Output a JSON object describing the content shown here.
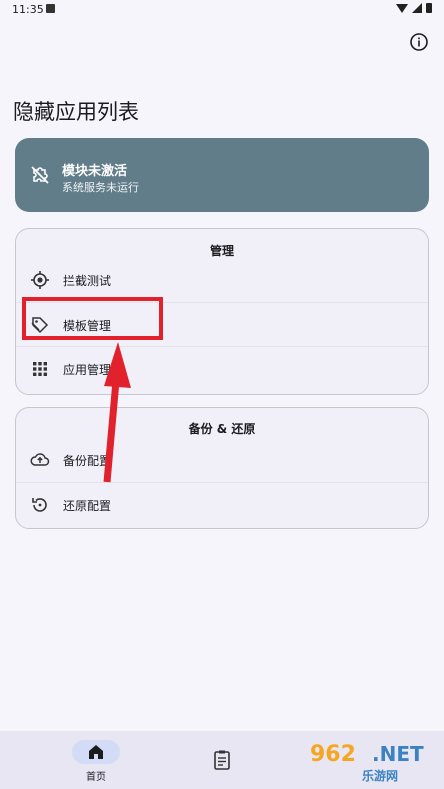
{
  "status_bar": {
    "time": "11:35"
  },
  "header": {
    "title": "隐藏应用列表"
  },
  "module_status": {
    "title": "模块未激活",
    "subtitle": "系统服务未运行"
  },
  "management": {
    "title": "管理",
    "items": [
      {
        "label": "拦截测试",
        "icon": "target-icon"
      },
      {
        "label": "模板管理",
        "icon": "tag-icon"
      },
      {
        "label": "应用管理",
        "icon": "apps-grid-icon"
      }
    ]
  },
  "backup": {
    "title": "备份 & 还原",
    "items": [
      {
        "label": "备份配置",
        "icon": "cloud-upload-icon"
      },
      {
        "label": "还原配置",
        "icon": "restore-icon"
      }
    ]
  },
  "bottom_nav": {
    "home_label": "首页"
  },
  "watermark": {
    "main": "962",
    "net": ".NET",
    "sub": "乐游网"
  },
  "colors": {
    "module_card": "#627d8a",
    "highlight": "#e1212b",
    "nav_pill": "#d3dbf7"
  }
}
